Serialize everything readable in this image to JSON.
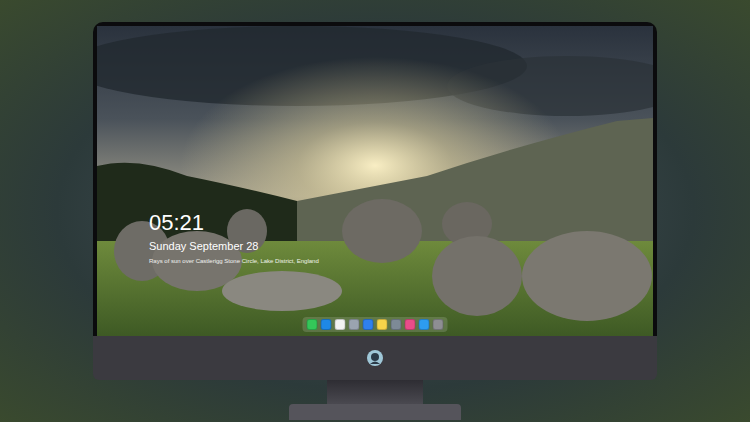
{
  "lock_screen": {
    "time": "05:21",
    "date": "Sunday September 28",
    "caption": "Rays of sun over Castlerigg Stone Circle, Lake District, England"
  },
  "dock": {
    "icons": [
      {
        "color": "#34c759"
      },
      {
        "color": "#1e88e5"
      },
      {
        "color": "#f2f2f2"
      },
      {
        "color": "#9aa4b0"
      },
      {
        "color": "#2f80ed"
      },
      {
        "color": "#f7d54a"
      },
      {
        "color": "#7d8a96"
      },
      {
        "color": "#e94c89"
      },
      {
        "color": "#2d9cf0"
      },
      {
        "color": "#8e8e93"
      }
    ]
  }
}
